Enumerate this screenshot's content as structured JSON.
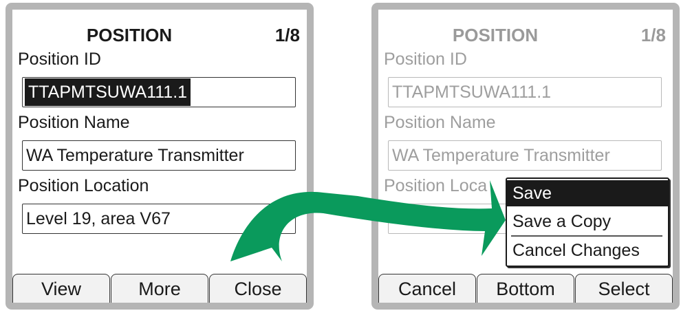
{
  "left_screen": {
    "title": "POSITION",
    "page_indicator": "1/8",
    "fields": [
      {
        "label": "Position ID",
        "value": "TTAPMTSUWA111.1"
      },
      {
        "label": "Position Name",
        "value": "WA Temperature Transmitter"
      },
      {
        "label": "Position Location",
        "value": "Level 19, area V67"
      }
    ],
    "softkeys": [
      "View",
      "More",
      "Close"
    ]
  },
  "right_screen": {
    "title": "POSITION",
    "page_indicator": "1/8",
    "fields": [
      {
        "label": "Position ID",
        "value": "TTAPMTSUWA111.1"
      },
      {
        "label": "Position Name",
        "value": "WA Temperature Transmitter"
      },
      {
        "label": "Position Loca",
        "value": ""
      }
    ],
    "softkeys": [
      "Cancel",
      "Bottom",
      "Select"
    ],
    "menu": {
      "items": [
        "Save",
        "Save a Copy",
        "Cancel Changes"
      ],
      "selected": "Save"
    }
  },
  "colors": {
    "arrow": "#0a9a5c",
    "frame": "#b5b5b5",
    "selection": "#1a1a1a",
    "disabled_text": "#9e9e9e"
  }
}
